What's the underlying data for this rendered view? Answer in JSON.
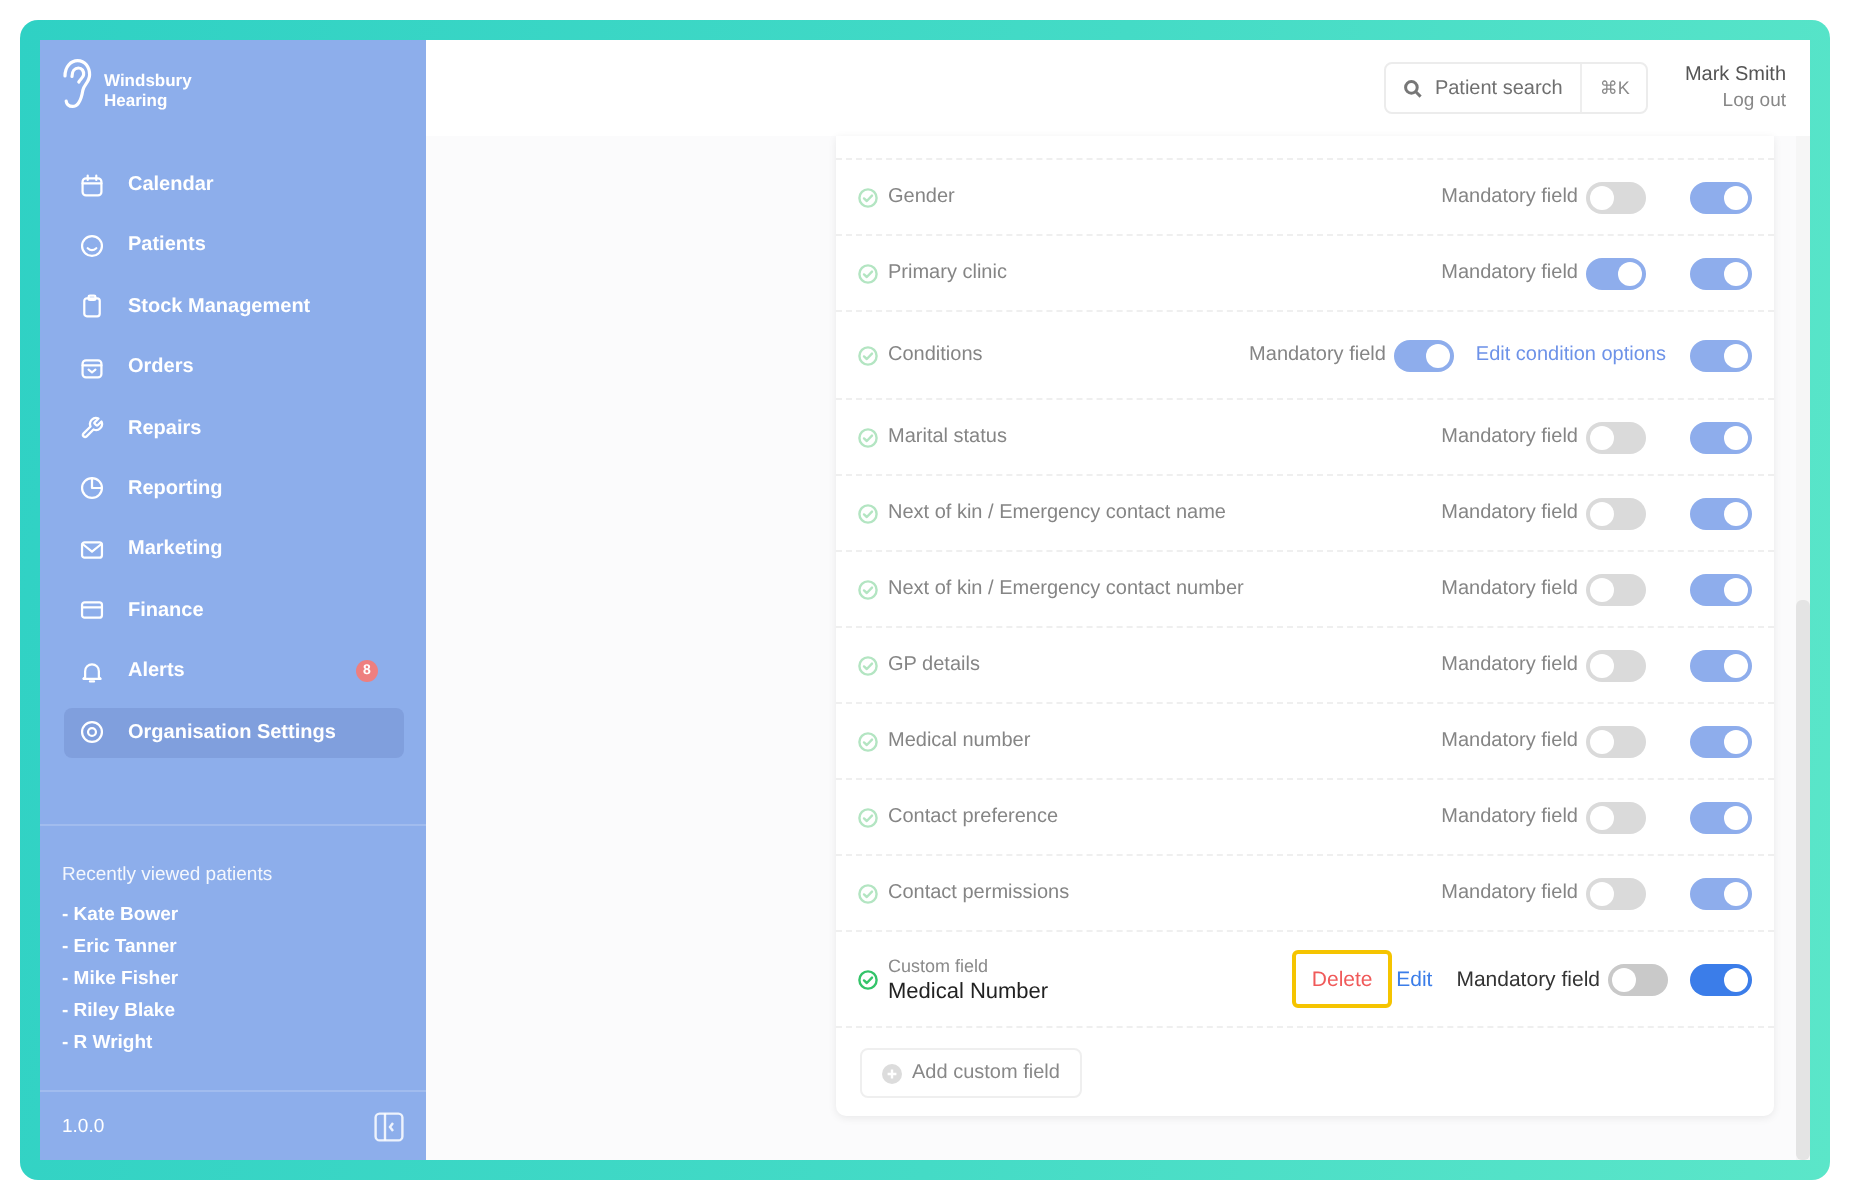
{
  "sidebar": {
    "logo": "Windsbury Hearing",
    "nav": [
      {
        "label": "Calendar",
        "selected": false
      },
      {
        "label": "Patients",
        "selected": false
      },
      {
        "label": "Stock Management",
        "selected": false
      },
      {
        "label": "Orders",
        "selected": false
      },
      {
        "label": "Repairs",
        "selected": false
      },
      {
        "label": "Reporting",
        "selected": false
      },
      {
        "label": "Marketing",
        "selected": false
      },
      {
        "label": "Finance",
        "selected": false
      },
      {
        "label": "Alerts",
        "selected": false,
        "badge": "8"
      },
      {
        "label": "Organisation Settings",
        "selected": true
      }
    ],
    "recent": {
      "title": "Recently viewed patients",
      "patients": [
        "- Kate Bower",
        "- Eric Tanner",
        "- Mike Fisher",
        "- Riley Blake",
        "- R Wright"
      ]
    },
    "version": "1.0.0"
  },
  "header": {
    "search": {
      "placeholder": "Patient search",
      "shortcut": "⌘K"
    },
    "user": {
      "name": "Mark Smith",
      "logout": "Log out"
    }
  },
  "fields": [
    {
      "kind": "standard",
      "label": "Gender",
      "mandatory_label": "Mandatory field",
      "mandatory": false,
      "enabled": true,
      "focused": false
    },
    {
      "kind": "standard",
      "label": "Primary clinic",
      "mandatory_label": "Mandatory field",
      "mandatory": true,
      "enabled": true,
      "focused": false
    },
    {
      "kind": "standard",
      "label": "Conditions",
      "mandatory_label": "Mandatory field",
      "mandatory": true,
      "link": "Edit condition options",
      "enabled": true,
      "focused": false
    },
    {
      "kind": "standard",
      "label": "Marital status",
      "mandatory_label": "Mandatory field",
      "mandatory": false,
      "enabled": true,
      "focused": false
    },
    {
      "kind": "standard",
      "label": "Next of kin / Emergency contact name",
      "mandatory_label": "Mandatory field",
      "mandatory": false,
      "enabled": true,
      "focused": false
    },
    {
      "kind": "standard",
      "label": "Next of kin / Emergency contact number",
      "mandatory_label": "Mandatory field",
      "mandatory": false,
      "enabled": true,
      "focused": false
    },
    {
      "kind": "standard",
      "label": "GP details",
      "mandatory_label": "Mandatory field",
      "mandatory": false,
      "enabled": true,
      "focused": false
    },
    {
      "kind": "standard",
      "label": "Medical number",
      "mandatory_label": "Mandatory field",
      "mandatory": false,
      "enabled": true,
      "focused": false
    },
    {
      "kind": "standard",
      "label": "Contact preference",
      "mandatory_label": "Mandatory field",
      "mandatory": false,
      "enabled": true,
      "focused": false
    },
    {
      "kind": "standard",
      "label": "Contact permissions",
      "mandatory_label": "Mandatory field",
      "mandatory": false,
      "enabled": true,
      "focused": false
    },
    {
      "kind": "custom",
      "caption": "Custom field",
      "label": "Medical Number",
      "delete": {
        "label": "Delete",
        "outlined": true
      },
      "edit": "Edit",
      "mandatory_label": "Mandatory field",
      "mandatory": false,
      "enabled": true,
      "focused": true
    }
  ],
  "add_button": "Add custom field"
}
